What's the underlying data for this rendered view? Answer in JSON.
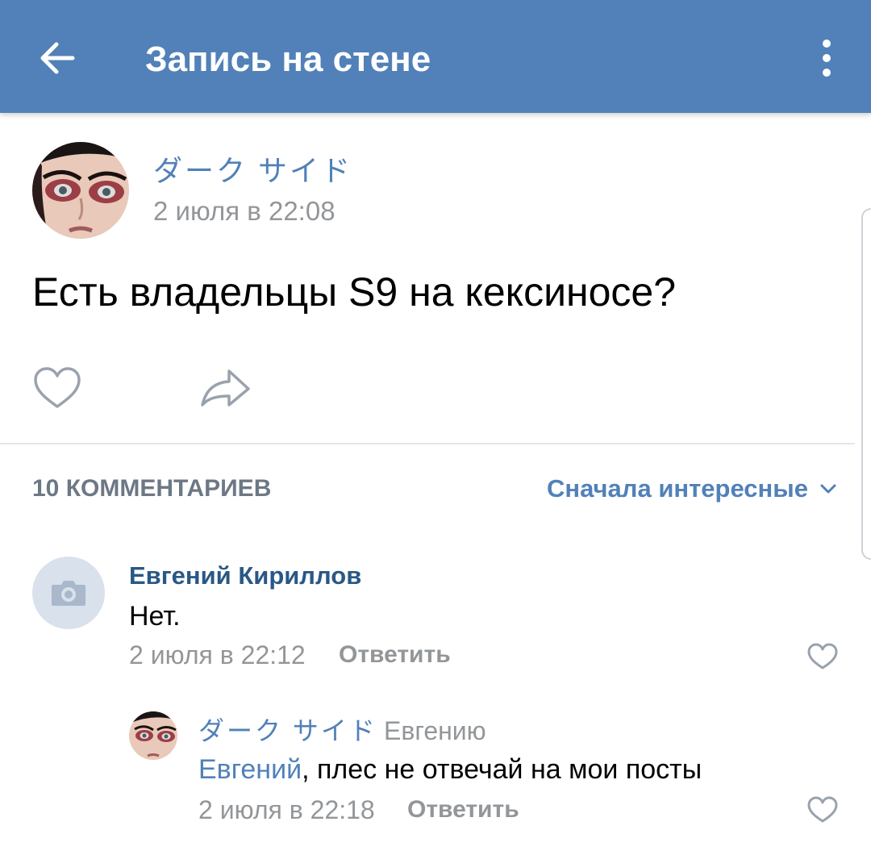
{
  "header": {
    "title": "Запись на стене",
    "back_icon": "arrow-left-icon",
    "menu_icon": "more-vertical-icon",
    "background": "#5181b8"
  },
  "post": {
    "author": "ダーク サイド",
    "date": "2 июля в 22:08",
    "text": "Есть владельцы S9 на кексиносе?",
    "like_icon": "heart-outline-icon",
    "share_icon": "share-arrow-icon"
  },
  "comments_section": {
    "count_label": "10 КОММЕНТАРИЕВ",
    "sort_label": "Сначала интересные",
    "sort_icon": "chevron-down-icon"
  },
  "comments": [
    {
      "author": "Евгений Кириллов",
      "avatar_icon": "camera-placeholder-icon",
      "text": "Нет.",
      "date": "2 июля в 22:12",
      "reply_label": "Ответить",
      "like_icon": "heart-outline-icon"
    },
    {
      "author": "ダーク サイド",
      "reply_to": "Евгению",
      "mention": "Евгений",
      "text": ", плес не отвечай на мои посты",
      "date": "2 июля в 22:18",
      "reply_label": "Ответить",
      "like_icon": "heart-outline-icon"
    }
  ],
  "colors": {
    "accent": "#5181b8",
    "comment_author": "#2a5885",
    "secondary_text": "#939699",
    "divider": "#e4e6ea"
  }
}
